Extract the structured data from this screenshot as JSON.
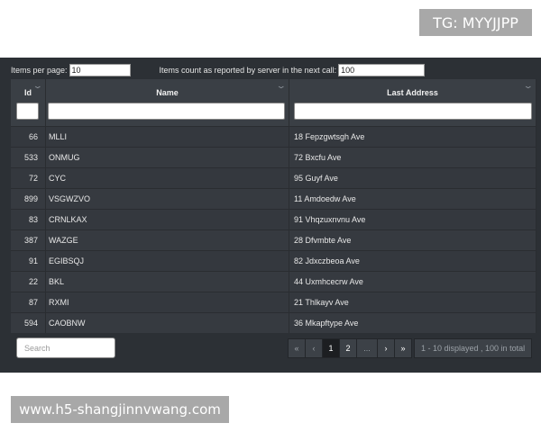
{
  "badge": "TG: MYYJJPP",
  "watermark": "www.h5-shangjinnvwang.com",
  "topbar": {
    "items_per_page_label": "Items per page:",
    "items_per_page_value": "10",
    "server_count_label": "Items count as reported by server in the next call:",
    "server_count_value": "100"
  },
  "columns": {
    "id": "Id",
    "name": "Name",
    "address": "Last Address"
  },
  "rows": [
    {
      "id": "66",
      "name": "MLLI",
      "address": "18 Fepzgwtsgh Ave"
    },
    {
      "id": "533",
      "name": "ONMUG",
      "address": "72 Bxcfu Ave"
    },
    {
      "id": "72",
      "name": "CYC",
      "address": "95 Guyf Ave"
    },
    {
      "id": "899",
      "name": "VSGWZVO",
      "address": "11 Amdoedw Ave"
    },
    {
      "id": "83",
      "name": "CRNLKAX",
      "address": "91 Vhqzuxnvnu Ave"
    },
    {
      "id": "387",
      "name": "WAZGE",
      "address": "28 Dfvmbte Ave"
    },
    {
      "id": "91",
      "name": "EGIBSQJ",
      "address": "82 Jdxczbeoa Ave"
    },
    {
      "id": "22",
      "name": "BKL",
      "address": "44 Uxmhcecrw Ave"
    },
    {
      "id": "87",
      "name": "RXMI",
      "address": "21 Thlkayv Ave"
    },
    {
      "id": "594",
      "name": "CAOBNW",
      "address": "36 Mkapftype Ave"
    }
  ],
  "footer": {
    "search_placeholder": "Search",
    "pager": {
      "first": "«",
      "prev": "‹",
      "page1": "1",
      "page2": "2",
      "ellipsis": "...",
      "next": "›",
      "last": "»",
      "info": "1 - 10 displayed , 100 in total"
    }
  }
}
